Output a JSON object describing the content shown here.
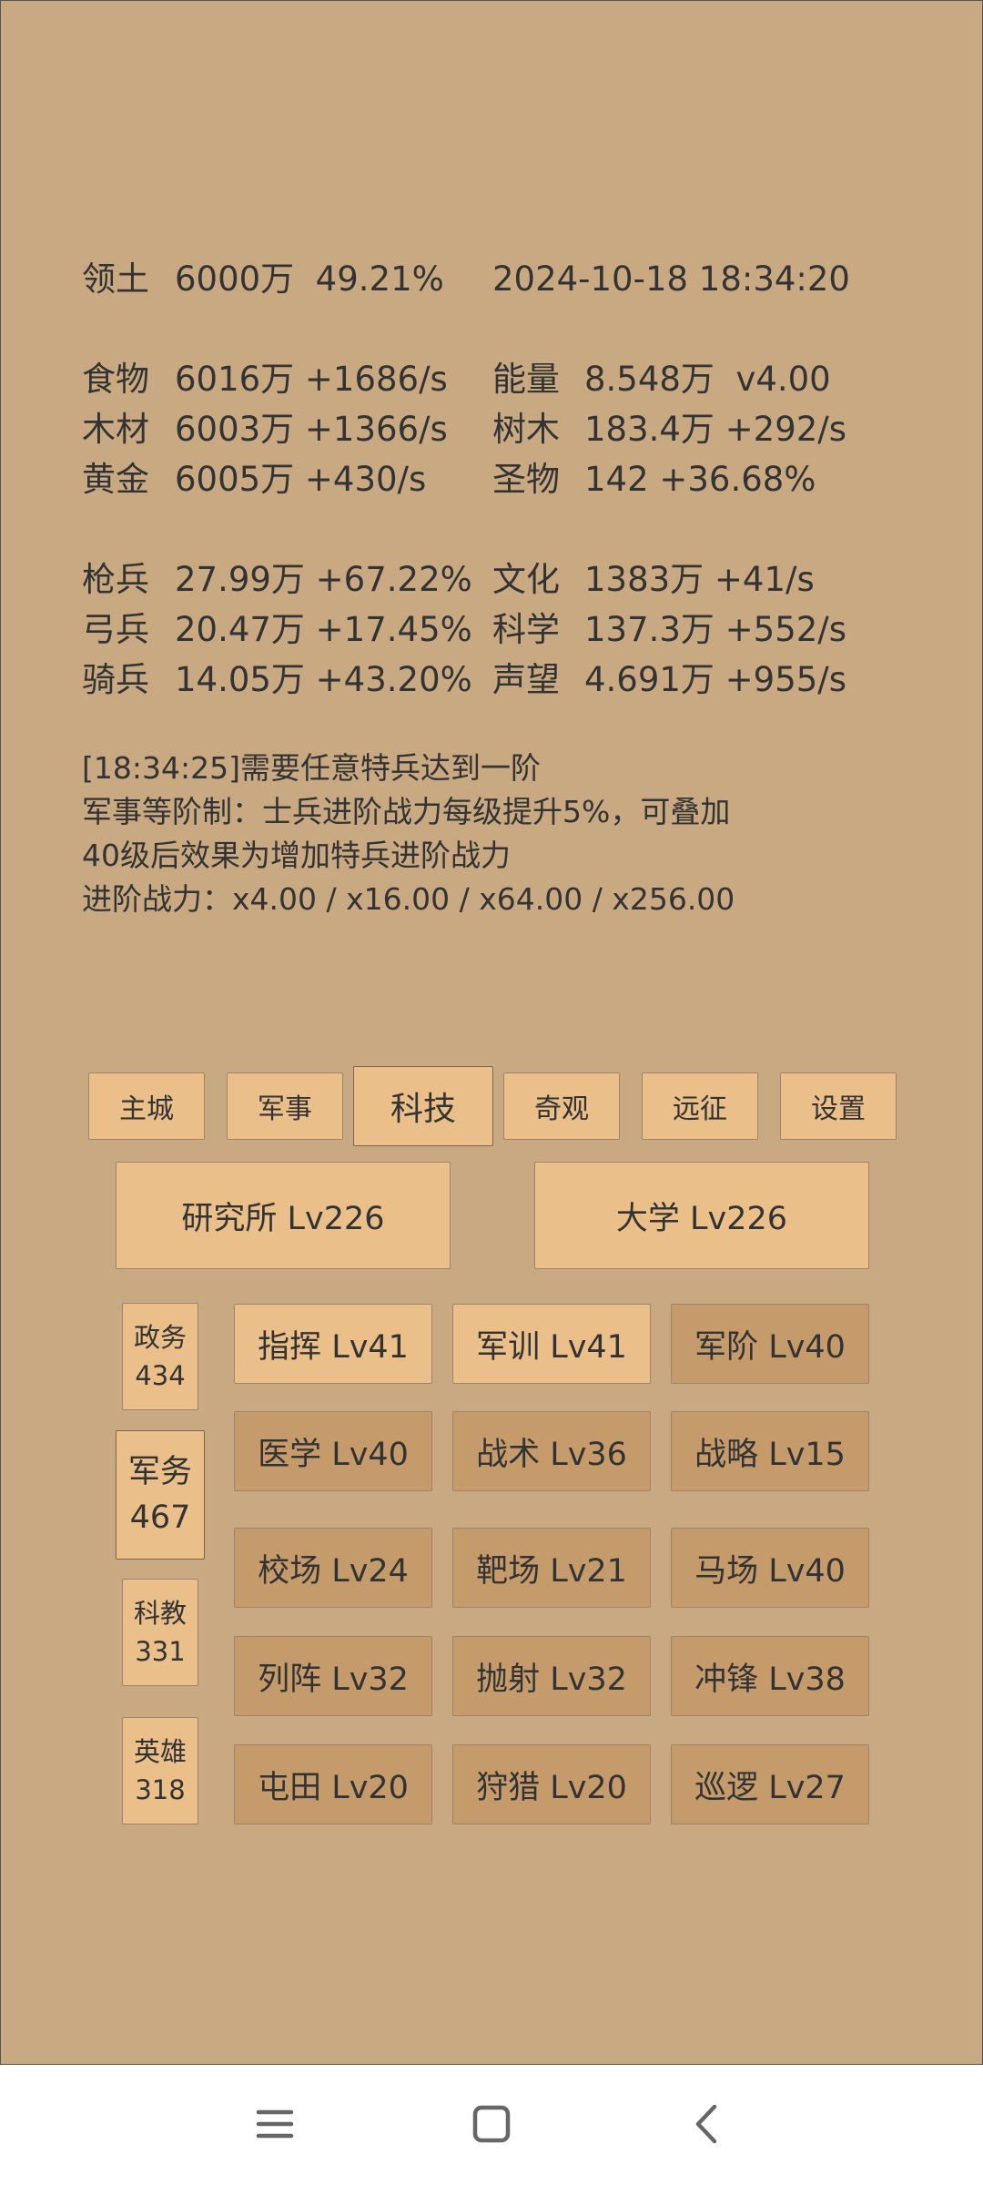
{
  "stats": {
    "territory_label": "领土",
    "territory_value": "6000万  49.21%",
    "datetime": "2024-10-18 18:34:20",
    "food_label": "食物",
    "food_value": "6016万 +1686/s",
    "energy_label": "能量",
    "energy_value": "8.548万  v4.00",
    "wood_label": "木材",
    "wood_value": "6003万 +1366/s",
    "tree_label": "树木",
    "tree_value": "183.4万 +292/s",
    "gold_label": "黄金",
    "gold_value": "6005万 +430/s",
    "relic_label": "圣物",
    "relic_value": "142 +36.68%",
    "spear_label": "枪兵",
    "spear_value": "27.99万 +67.22%",
    "culture_label": "文化",
    "culture_value": "1383万 +41/s",
    "archer_label": "弓兵",
    "archer_value": "20.47万 +17.45%",
    "science_label": "科学",
    "science_value": "137.3万 +552/s",
    "cavalry_label": "骑兵",
    "cavalry_value": "14.05万 +43.20%",
    "prestige_label": "声望",
    "prestige_value": "4.691万 +955/s"
  },
  "message": {
    "line1": "[18:34:25]需要任意特兵达到一阶",
    "line2": "军事等阶制：士兵进阶战力每级提升5%，可叠加",
    "line3": "40级后效果为增加特兵进阶战力",
    "line4": "进阶战力：x4.00 / x16.00 / x64.00 / x256.00"
  },
  "tabs": {
    "main_city": "主城",
    "military": "军事",
    "tech": "科技",
    "wonders": "奇观",
    "expedition": "远征",
    "settings": "设置"
  },
  "buildings": {
    "institute": "研究所 Lv226",
    "university": "大学 Lv226"
  },
  "categories": [
    {
      "name": "政务",
      "count": "434"
    },
    {
      "name": "军务",
      "count": "467"
    },
    {
      "name": "科教",
      "count": "331"
    },
    {
      "name": "英雄",
      "count": "318"
    }
  ],
  "techs": {
    "command": "指挥 Lv41",
    "training": "军训 Lv41",
    "rank": "军阶 Lv40",
    "medicine": "医学 Lv40",
    "tactics": "战术 Lv36",
    "strategy": "战略 Lv15",
    "drill_ground": "校场 Lv24",
    "shooting_range": "靶场 Lv21",
    "stable": "马场 Lv40",
    "formation": "列阵 Lv32",
    "throwing": "抛射 Lv32",
    "charge": "冲锋 Lv38",
    "farming": "屯田 Lv20",
    "hunting": "狩猎 Lv20",
    "patrol": "巡逻 Lv27"
  },
  "colors": {
    "background": "#c9a982",
    "button_light": "#ebbf8a",
    "button_dark": "#c59b6b",
    "text": "#333333"
  },
  "navbar": {
    "icons": [
      "menu-icon",
      "home-icon",
      "back-icon"
    ]
  }
}
